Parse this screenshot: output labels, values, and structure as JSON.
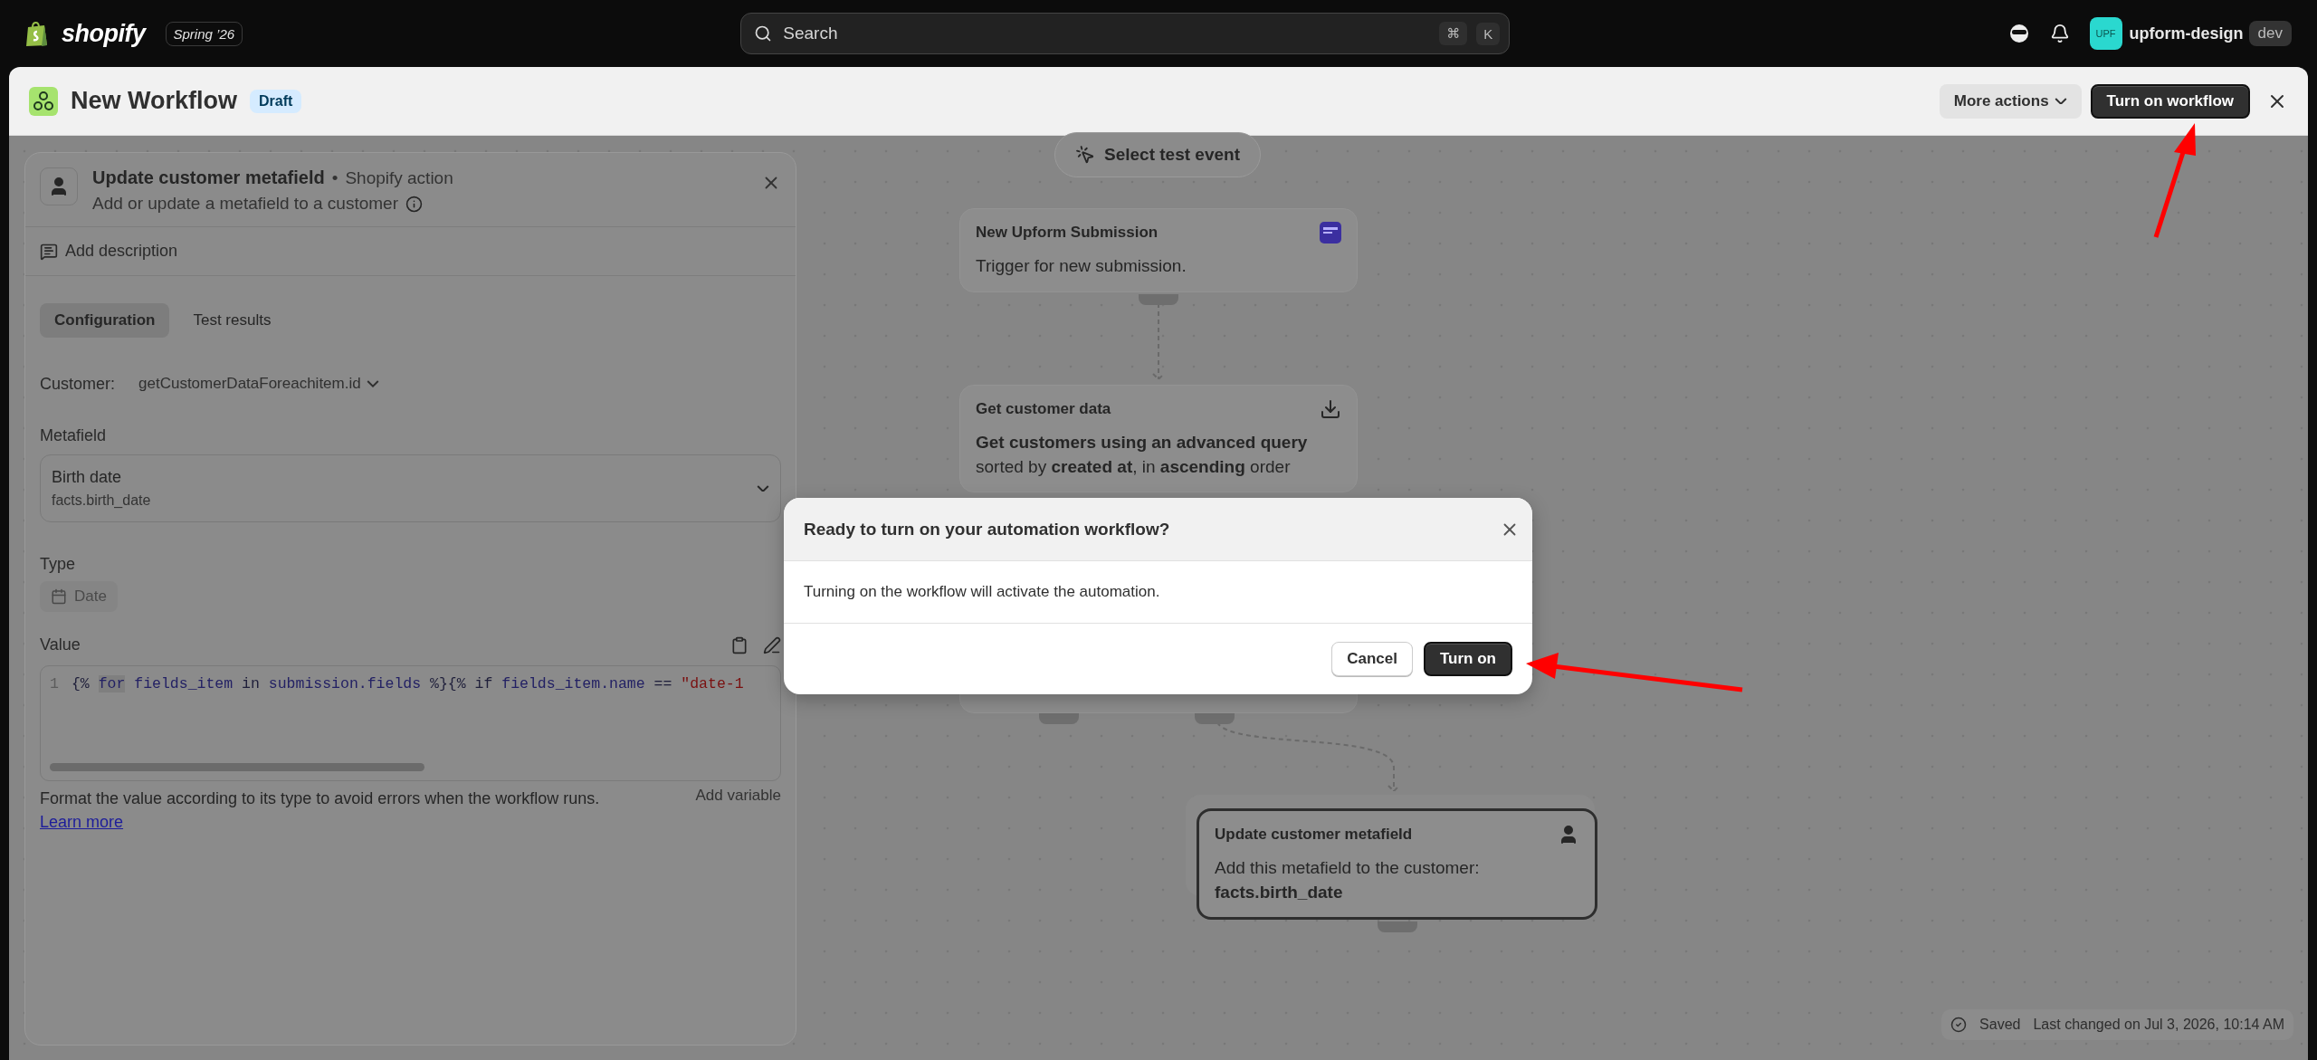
{
  "topbar": {
    "brand": "shopify",
    "edition": "Spring ’26",
    "search": {
      "placeholder": "Search",
      "keys": [
        "⌘",
        "K"
      ]
    },
    "store": {
      "avatar": "UPF",
      "name": "upform-design",
      "badge": "dev"
    }
  },
  "header": {
    "title": "New Workflow",
    "status": "Draft",
    "buttons": [
      {
        "label": "More actions",
        "kind": "menu"
      },
      {
        "label": "Turn on workflow",
        "kind": "primary"
      }
    ]
  },
  "panel": {
    "title": "Update customer metafield",
    "separator": "•",
    "source": "Shopify action",
    "description": "Add or update a metafield to a customer",
    "add_description": "Add description",
    "tabs": [
      {
        "label": "Configuration",
        "selected": true
      },
      {
        "label": "Test results",
        "selected": false
      }
    ],
    "customer": {
      "label": "Customer:",
      "value": "getCustomerDataForeachitem.id"
    },
    "metafield": {
      "label": "Metafield",
      "name": "Birth date",
      "key": "facts.birth_date"
    },
    "type": {
      "label": "Type",
      "value": "Date",
      "disabled": true
    },
    "value": {
      "label": "Value",
      "line_number": "1",
      "code": [
        {
          "text": "{% ",
          "kind": "punct"
        },
        {
          "text": "for",
          "kind": "keyword"
        },
        {
          "text": " fields_item ",
          "kind": "ident"
        },
        {
          "text": "in",
          "kind": "punct"
        },
        {
          "text": " submission.fields ",
          "kind": "ident"
        },
        {
          "text": "%}{% if ",
          "kind": "punct"
        },
        {
          "text": "fields_item.name",
          "kind": "ident"
        },
        {
          "text": " == ",
          "kind": "punct"
        },
        {
          "text": "\"date-1",
          "kind": "string"
        }
      ]
    },
    "help": "Format the value according to its type to avoid errors when the workflow runs.",
    "help_link": "Learn more",
    "add_variable": "Add variable"
  },
  "canvas": {
    "test_event": "Select test event",
    "nodes": [
      {
        "kind": "trigger",
        "title": "New Upform Submission",
        "lines": [
          "Trigger for new submission."
        ],
        "selected": false
      },
      {
        "kind": "fetch",
        "title": "Get customer data",
        "lines": [
          "**Get customers using an advanced query** sorted by **created at**, in **ascending** order"
        ],
        "selected": false
      },
      {
        "kind": "loop",
        "selected": false
      },
      {
        "kind": "customer",
        "title": "Update customer metafield",
        "lines": [
          "Add this metafield to the customer:",
          "**facts.birth_date**"
        ],
        "selected": true
      }
    ],
    "status": {
      "state": "Saved",
      "detail": "Last changed on Jul 3, 2026, 10:14 AM"
    }
  },
  "dialog": {
    "title": "Ready to turn on your automation workflow?",
    "message": "Turning on the workflow will activate the automation.",
    "buttons": [
      {
        "label": "Cancel",
        "kind": "secondary"
      },
      {
        "label": "Turn on",
        "kind": "primary"
      }
    ]
  }
}
